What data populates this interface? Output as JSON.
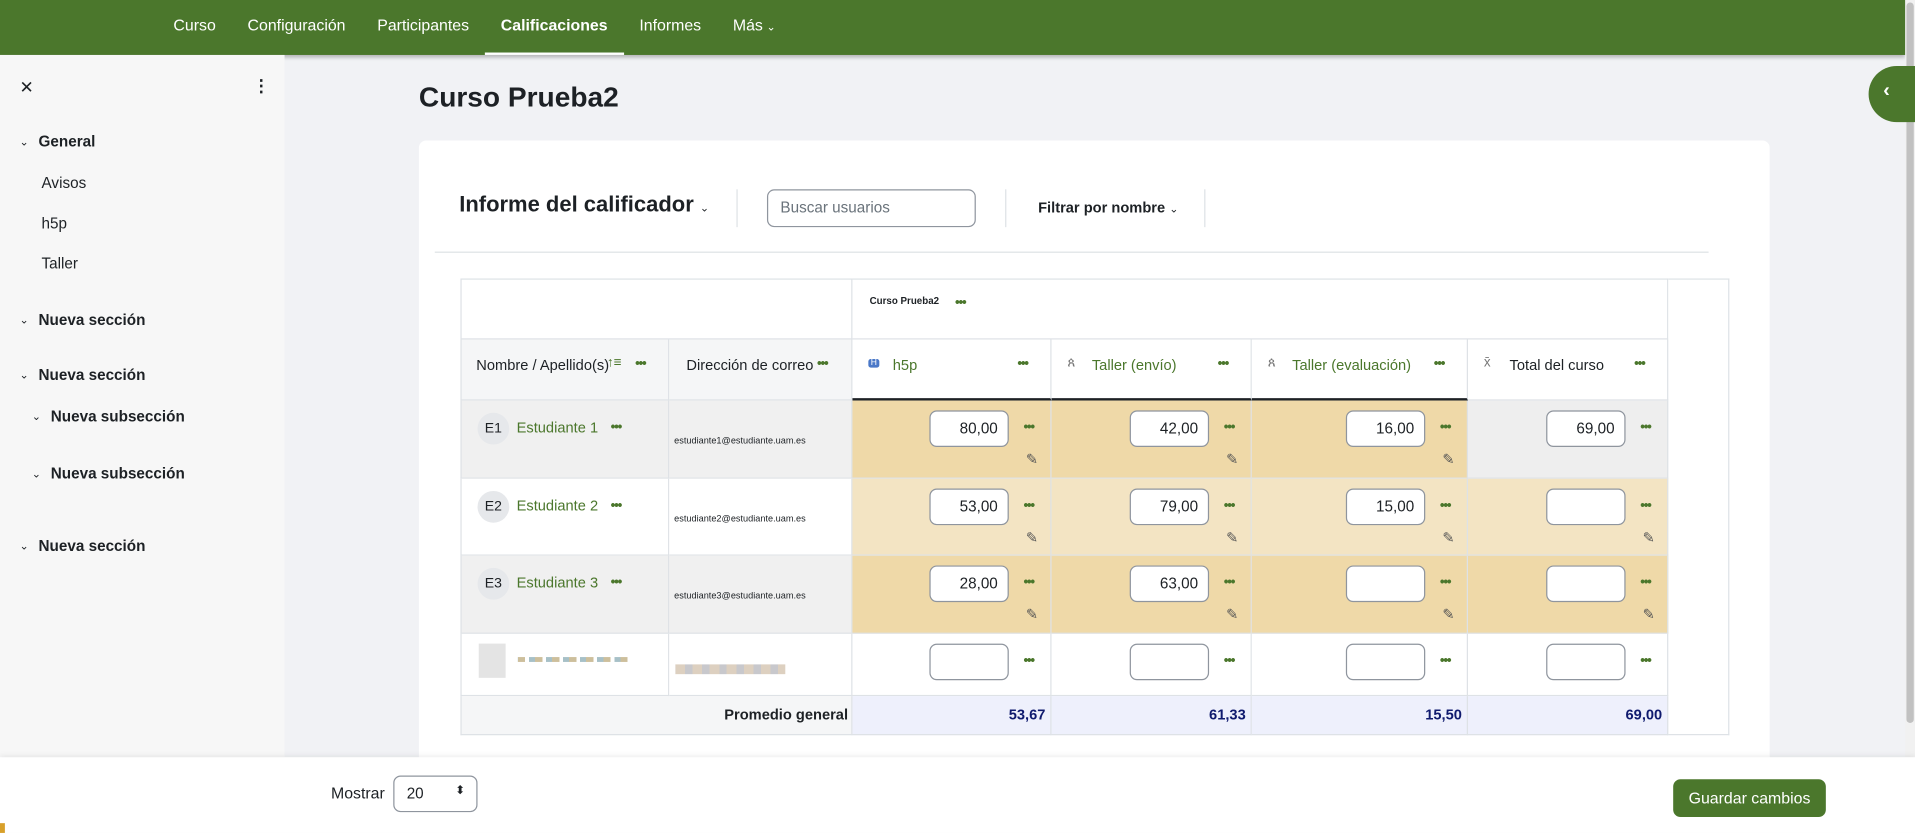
{
  "nav": {
    "items": [
      "Curso",
      "Configuración",
      "Participantes",
      "Calificaciones",
      "Informes",
      "Más"
    ],
    "active": "Calificaciones"
  },
  "sidebar": {
    "items": [
      {
        "label": "General",
        "type": "section"
      },
      {
        "label": "Avisos",
        "type": "item"
      },
      {
        "label": "h5p",
        "type": "item"
      },
      {
        "label": "Taller",
        "type": "item"
      },
      {
        "label": "Nueva sección",
        "type": "section"
      },
      {
        "label": "Nueva sección",
        "type": "section"
      },
      {
        "label": "Nueva subsección",
        "type": "subsection"
      },
      {
        "label": "Nueva subsección",
        "type": "subsection"
      },
      {
        "label": "Nueva sección",
        "type": "section"
      }
    ]
  },
  "page_title": "Curso Prueba2",
  "toolbar": {
    "report": "Informe del calificador",
    "search_placeholder": "Buscar usuarios",
    "filter": "Filtrar por nombre"
  },
  "table": {
    "category": "Curso Prueba2",
    "headers": {
      "name": "Nombre / Apellido(s)",
      "email": "Dirección de correo",
      "items": [
        "h5p",
        "Taller (envío)",
        "Taller (evaluación)",
        "Total del curso"
      ]
    },
    "rows": [
      {
        "initials": "E1",
        "name": "Estudiante 1",
        "email": "estudiante1@estudiante.uam.es",
        "grades": [
          "80,00",
          "42,00",
          "16,00",
          "69,00"
        ]
      },
      {
        "initials": "E2",
        "name": "Estudiante 2",
        "email": "estudiante2@estudiante.uam.es",
        "grades": [
          "53,00",
          "79,00",
          "15,00",
          ""
        ]
      },
      {
        "initials": "E3",
        "name": "Estudiante 3",
        "email": "estudiante3@estudiante.uam.es",
        "grades": [
          "28,00",
          "63,00",
          "",
          ""
        ]
      },
      {
        "initials": "",
        "name": "",
        "email": "",
        "grades": [
          "",
          "",
          "",
          ""
        ]
      }
    ],
    "average_label": "Promedio general",
    "averages": [
      "53,67",
      "61,33",
      "15,50",
      "69,00"
    ]
  },
  "footer": {
    "show_label": "Mostrar",
    "per_page": "20",
    "save": "Guardar cambios"
  },
  "colors": {
    "brand": "#4b772c",
    "graded_dark": "#efd9a8",
    "graded_light": "#f3e4c3"
  }
}
